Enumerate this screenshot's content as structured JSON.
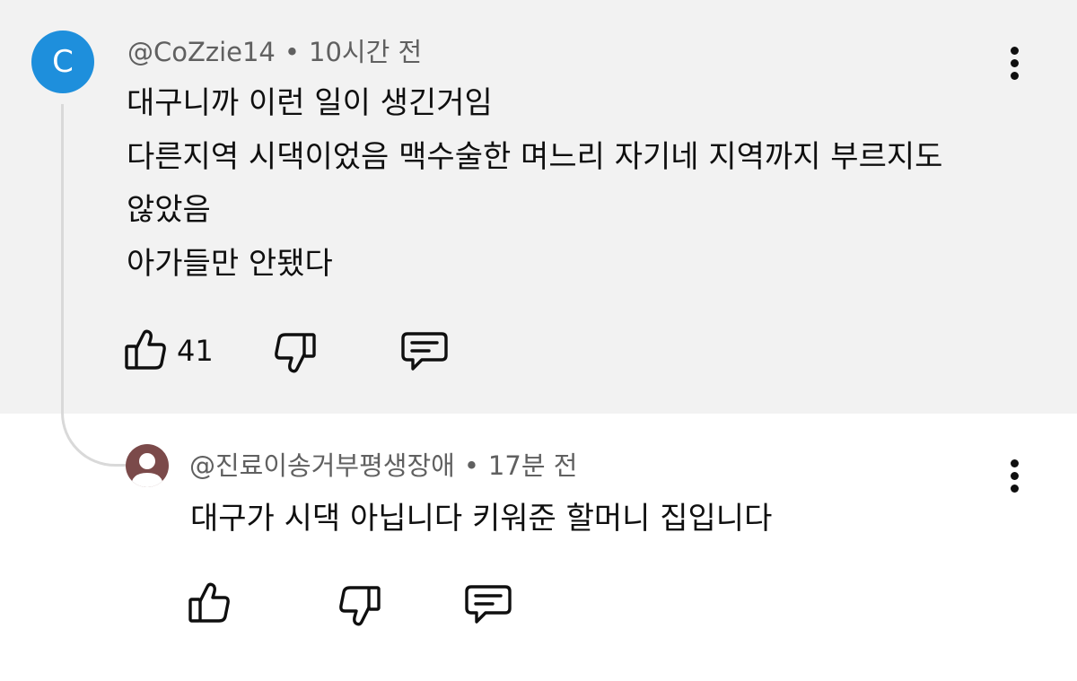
{
  "comment": {
    "avatar_letter": "C",
    "author": "@CoZzie14",
    "separator": "•",
    "time": "10시간 전",
    "lines": [
      "대구니까 이런 일이 생긴거임",
      "다른지역 시댁이었음 맥수술한 며느리 자기네 지역까지 부르지도",
      "않았음",
      "아가들만 안됐다"
    ],
    "like_count": "41",
    "avatar_color": "#1e8fdc",
    "background_color": "#f2f2f2"
  },
  "reply": {
    "author": "@진료이송거부평생장애",
    "separator": "•",
    "time": "17분 전",
    "text": "대구가 시댁 아닙니다 키워준 할머니 집입니다",
    "avatar_color": "#7b4a4a"
  },
  "icons": {
    "like": "thumbs-up-icon",
    "dislike": "thumbs-down-icon",
    "reply": "comment-icon",
    "more": "more-vertical-icon"
  }
}
